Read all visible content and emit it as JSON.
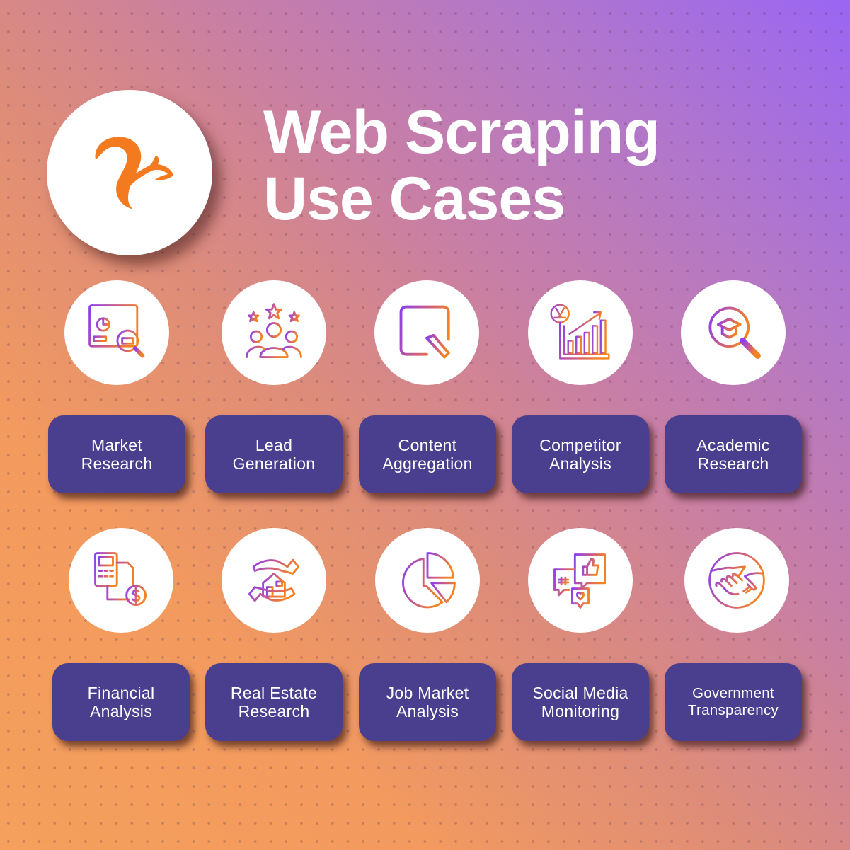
{
  "title": {
    "line1": "Web Scraping",
    "line2": "Use Cases"
  },
  "logo": {
    "icon": "squirrel-logo-icon",
    "color": "#f47a20"
  },
  "colors": {
    "pill_bg": "#4a3f8f",
    "icon_gradient_start": "#8a3ff0",
    "icon_gradient_end": "#f58220",
    "bg_orange": "#f5a05c",
    "bg_purple": "#9a66f3"
  },
  "use_cases": [
    {
      "line1": "Market",
      "line2": "Research",
      "icon": "market-research-dashboard-icon"
    },
    {
      "line1": "Lead",
      "line2": "Generation",
      "icon": "lead-generation-people-stars-icon"
    },
    {
      "line1": "Content",
      "line2": "Aggregation",
      "icon": "content-document-pencil-icon"
    },
    {
      "line1": "Competitor",
      "line2": "Analysis",
      "icon": "competitor-growth-chart-icon"
    },
    {
      "line1": "Academic",
      "line2": "Research",
      "icon": "academic-magnifier-cap-icon"
    },
    {
      "line1": "Financial",
      "line2": "Analysis",
      "icon": "financial-calculator-dollar-icon"
    },
    {
      "line1": "Real Estate",
      "line2": "Research",
      "icon": "real-estate-hands-house-icon"
    },
    {
      "line1": "Job Market",
      "line2": "Analysis",
      "icon": "job-market-pie-chart-icon"
    },
    {
      "line1": "Social Media",
      "line2": "Monitoring",
      "icon": "social-media-chat-bubbles-icon"
    },
    {
      "line1": "Government",
      "line2": "Transparency",
      "icon": "government-handshake-icon"
    }
  ]
}
